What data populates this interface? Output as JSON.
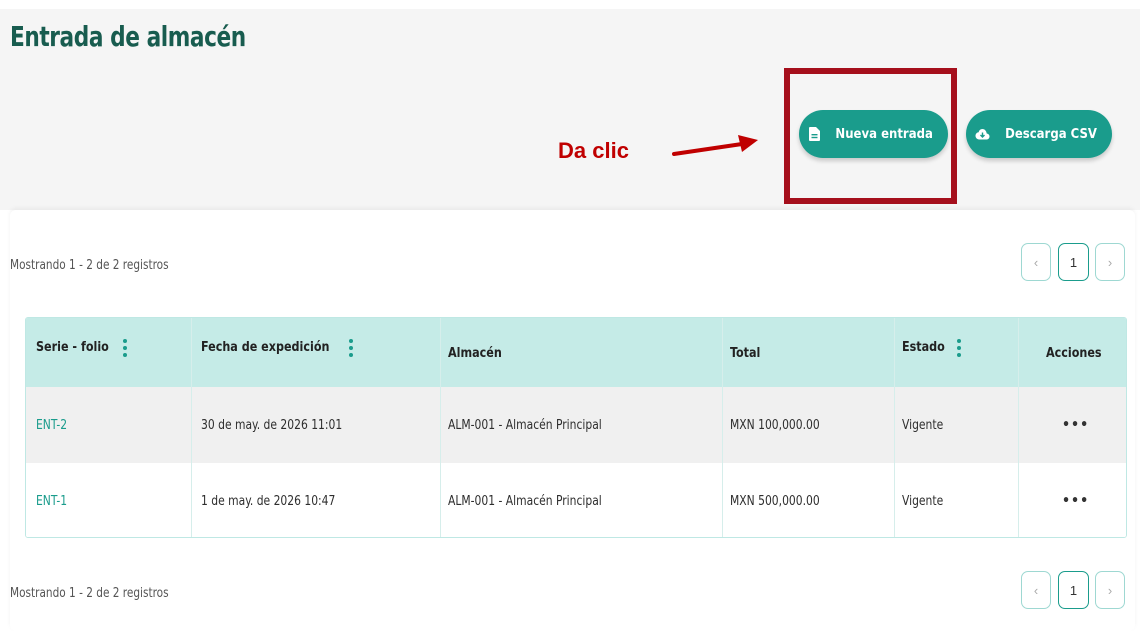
{
  "page": {
    "title": "Entrada de almacén"
  },
  "annotation": {
    "text": "Da clic"
  },
  "toolbar": {
    "new_entry_label": "Nueva entrada",
    "new_entry_icon": "document-icon",
    "csv_label": "Descarga CSV",
    "csv_icon": "cloud-download-icon"
  },
  "list": {
    "showing_text": "Mostrando 1 - 2 de 2 registros",
    "pagination": {
      "prev": "‹",
      "current": "1",
      "next": "›"
    },
    "columns": [
      "Serie - folio",
      "Fecha de expedición",
      "Almacén",
      "Total",
      "Estado",
      "Acciones"
    ],
    "rows": [
      {
        "folio": "ENT-2",
        "fecha": "30 de may. de 2026 11:01",
        "almacen": "ALM-001 - Almacén Principal",
        "total": "MXN 100,000.00",
        "estado": "Vigente",
        "acciones": "•••"
      },
      {
        "folio": "ENT-1",
        "fecha": "1 de may. de 2026 10:47",
        "almacen": "ALM-001 - Almacén Principal",
        "total": "MXN 500,000.00",
        "estado": "Vigente",
        "acciones": "•••"
      }
    ]
  },
  "colors": {
    "accent": "#1a9c8c",
    "title": "#185c4f",
    "header_bg": "#c5ebe7",
    "annotation": "#c00000"
  }
}
